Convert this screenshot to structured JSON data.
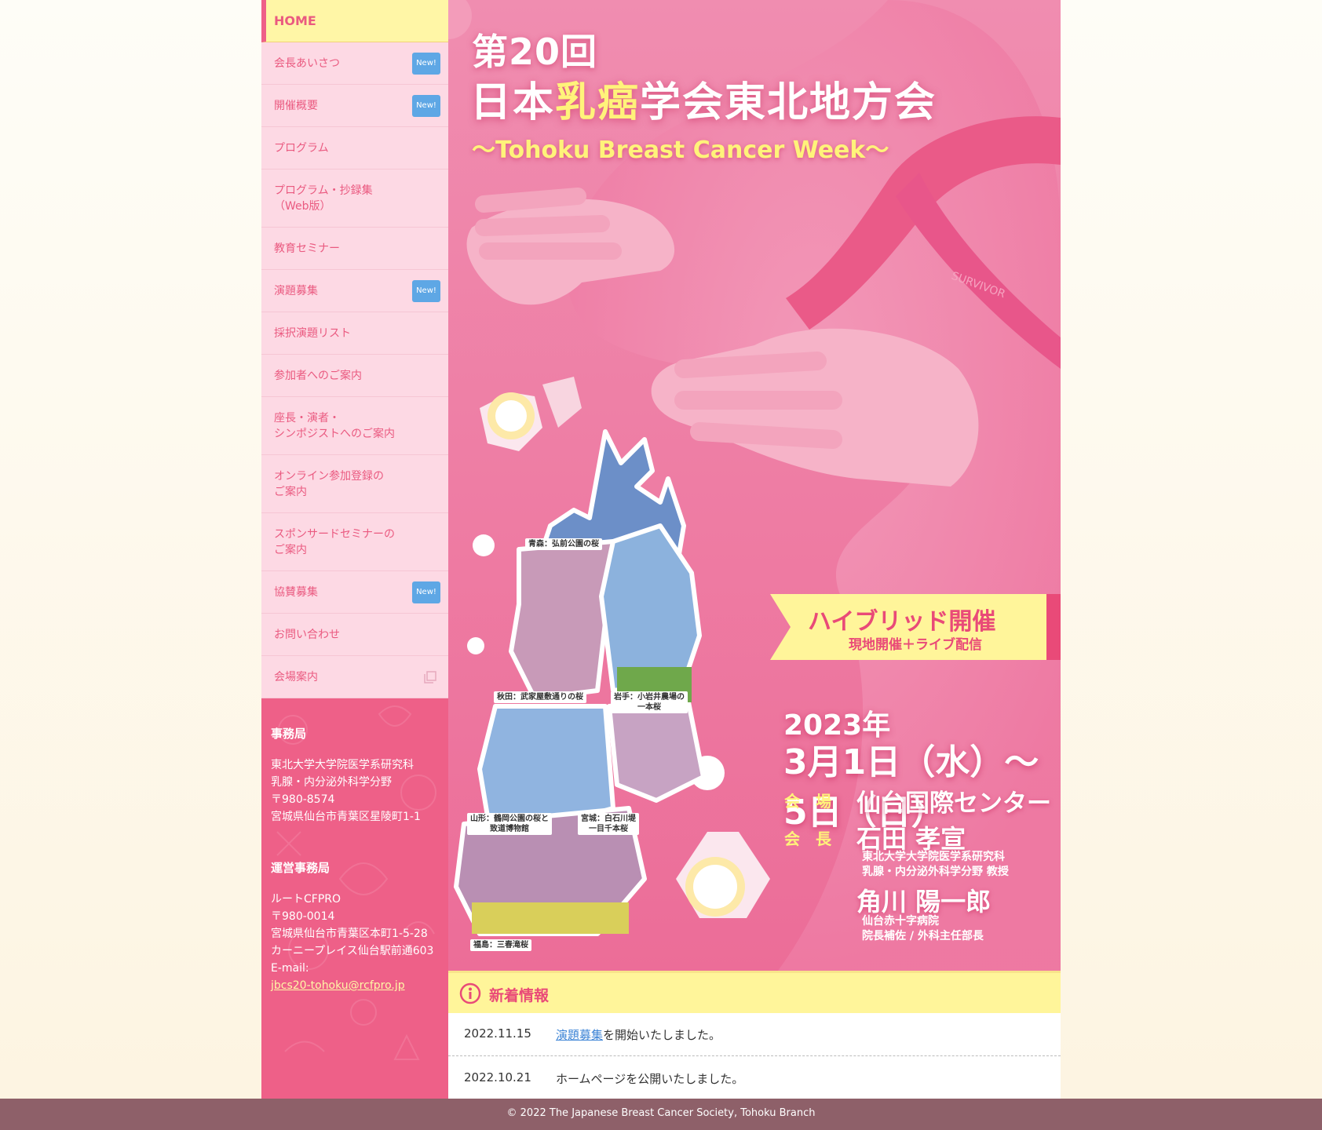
{
  "nav": {
    "items": [
      {
        "label": "HOME",
        "active": true
      },
      {
        "label": "会長あいさつ",
        "badge": "New!"
      },
      {
        "label": "開催概要",
        "badge": "New!"
      },
      {
        "label": "プログラム"
      },
      {
        "label": "プログラム・抄録集\n（Web版）"
      },
      {
        "label": "教育セミナー"
      },
      {
        "label": "演題募集",
        "badge": "New!"
      },
      {
        "label": "採択演題リスト"
      },
      {
        "label": "参加者へのご案内"
      },
      {
        "label": "座長・演者・\nシンポジストへのご案内"
      },
      {
        "label": "オンライン参加登録の\nご案内"
      },
      {
        "label": "スポンサードセミナーの\nご案内"
      },
      {
        "label": "協賛募集",
        "badge": "New!"
      },
      {
        "label": "お問い合わせ"
      },
      {
        "label": "会場案内",
        "icon": "external-window-icon"
      }
    ]
  },
  "secretariat": {
    "heading": "事務局",
    "lines": "東北大学大学院医学系研究科\n乳腺・内分泌外科学分野\n〒980-8574\n宮城県仙台市青葉区星陵町1-1"
  },
  "operations": {
    "heading": "運営事務局",
    "lines": "ルートCFPRO\n〒980-0014\n宮城県仙台市青葉区本町1-5-28\nカーニープレイス仙台駅前通603\nE-mail:",
    "email": "jbcs20-tohoku@rcfpro.jp"
  },
  "hero": {
    "edition": "第20回",
    "title_part1": "日本",
    "title_highlight": "乳癌",
    "title_part2": "学会東北地方会",
    "subtitle": "〜Tohoku Breast Cancer Week〜",
    "hybrid_main": "ハイブリッド開催",
    "hybrid_sub": "現地開催＋ライブ配信",
    "date_year": "2023年",
    "date_range": "3月1日（水）〜5日（日）",
    "venue_label": "会　場",
    "venue": "仙台国際センター",
    "president_label": "会　長",
    "president1_name": "石田 孝宣",
    "president1_affiliation": "東北大学大学院医学系研究科\n乳腺・内分泌外科学分野 教授",
    "president2_name": "角川 陽一郎",
    "president2_affiliation": "仙台赤十字病院\n院長補佐 / 外科主任部長",
    "map_labels": {
      "aomori": "青森：弘前公園の桜",
      "akita": "秋田：武家屋敷通りの桜",
      "iwate": "岩手：小岩井農場の\n一本桜",
      "yamagata": "山形：鶴岡公園の桜と\n致道博物館",
      "miyagi": "宮城：白石川堤\n一目千本桜",
      "fukushima": "福島：三春滝桜"
    },
    "ribbon_text": "SURVIVOR"
  },
  "news": {
    "heading": "新着情報",
    "items": [
      {
        "date": "2022.11.15",
        "link": "演題募集",
        "text": "を開始いたしました。"
      },
      {
        "date": "2022.10.21",
        "text": "ホームページを公開いたしました。"
      }
    ]
  },
  "footer": {
    "copyright": "© 2022 The Japanese Breast Cancer Society, Tohoku Branch"
  },
  "colors": {
    "brand_pink": "#ee6088",
    "nav_bg": "#fdd9e4",
    "home_bg": "#fff6a6",
    "badge_blue": "#5ea7e5",
    "footer_bg": "#8e6069"
  }
}
